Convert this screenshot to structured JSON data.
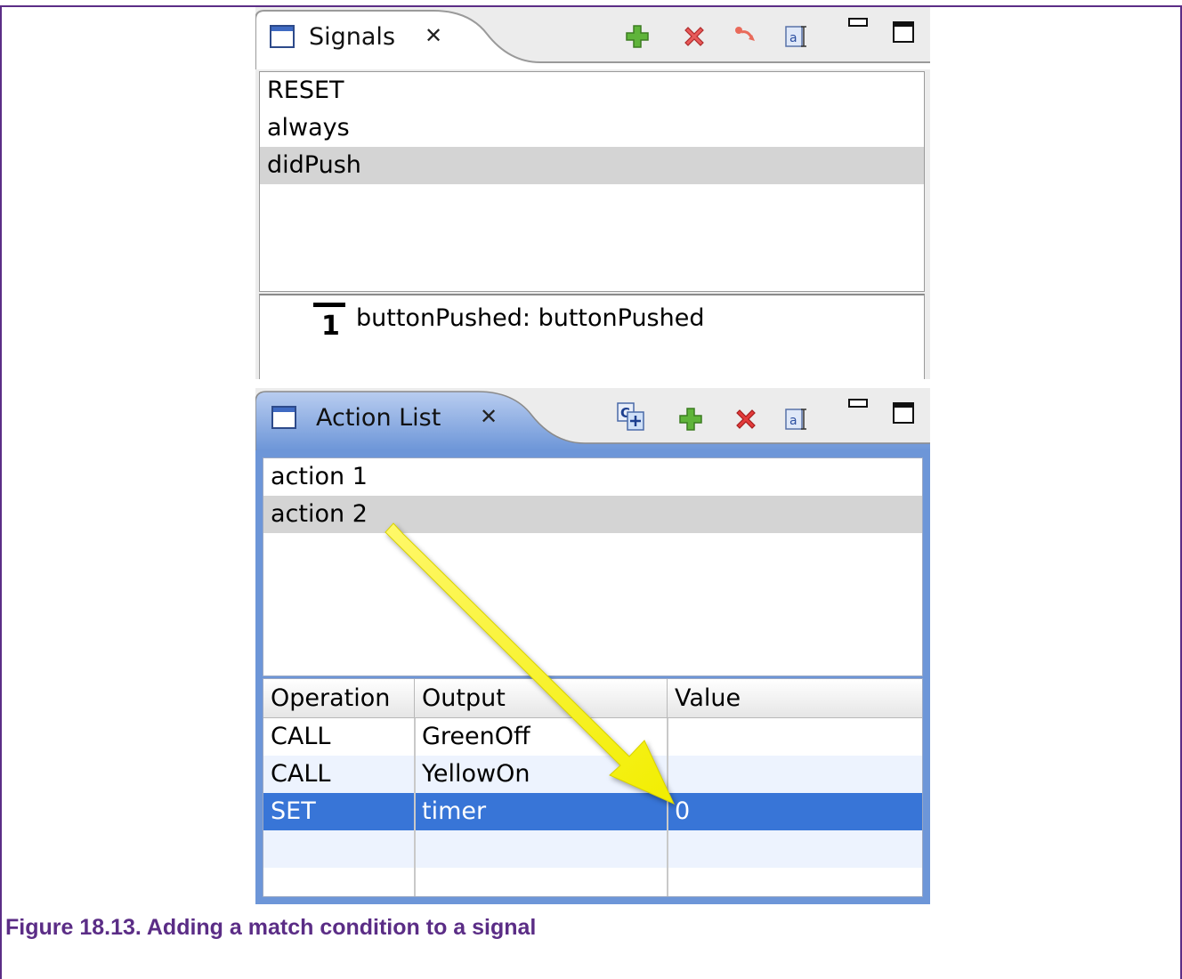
{
  "signals_view": {
    "title": "Signals",
    "toolbar": [
      "add-icon",
      "delete-icon",
      "link-icon",
      "rename-icon"
    ],
    "items": [
      {
        "label": "RESET",
        "selected": false
      },
      {
        "label": "always",
        "selected": false
      },
      {
        "label": "didPush",
        "selected": true
      }
    ],
    "detail": {
      "badge": "1",
      "text": "buttonPushed: buttonPushed"
    }
  },
  "action_view": {
    "title": "Action List",
    "toolbar": [
      "copy-icon",
      "add-icon",
      "delete-icon",
      "rename-icon"
    ],
    "items": [
      {
        "label": "action 1",
        "selected": false
      },
      {
        "label": "action 2",
        "selected": true
      }
    ],
    "table": {
      "columns": [
        "Operation",
        "Output",
        "Value"
      ],
      "rows": [
        {
          "operation": "CALL",
          "output": "GreenOff",
          "value": ""
        },
        {
          "operation": "CALL",
          "output": "YellowOn",
          "value": ""
        },
        {
          "operation": "SET",
          "output": "timer",
          "value": "0"
        }
      ]
    }
  },
  "colors": {
    "caption": "#5b2d86",
    "selection": "#3875d7",
    "active_view_border": "#6d96d8",
    "arrow": "#f5f200"
  },
  "caption": "Figure 18.13. Adding a match condition to a signal"
}
